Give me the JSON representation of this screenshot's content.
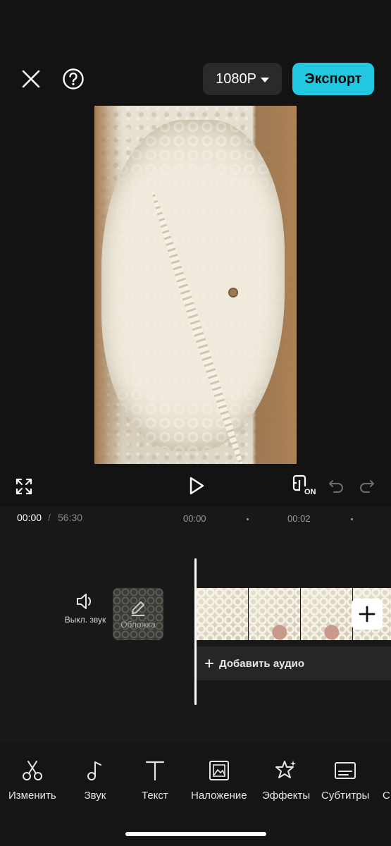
{
  "header": {
    "close_icon": "close-icon",
    "help_icon": "help-icon",
    "resolution_label": "1080P",
    "export_label": "Экспорт",
    "export_color": "#21c8e0"
  },
  "controls": {
    "fullscreen_icon": "fullscreen-icon",
    "play_icon": "play-icon",
    "preview_toggle_badge": "ON",
    "undo_icon": "undo-icon",
    "redo_icon": "redo-icon"
  },
  "timeline": {
    "current_time": "00:00",
    "separator": "/",
    "total_time": "56:30",
    "ticks": [
      "00:00",
      "00:02"
    ],
    "mute_label": "Выкл. звук",
    "cover_label": "Обложка",
    "add_audio_label": "Добавить аудио"
  },
  "toolbar": {
    "items": [
      {
        "label": "Изменить",
        "icon": "scissors-icon"
      },
      {
        "label": "Звук",
        "icon": "music-note-icon"
      },
      {
        "label": "Текст",
        "icon": "text-icon"
      },
      {
        "label": "Наложение",
        "icon": "overlay-icon"
      },
      {
        "label": "Эффекты",
        "icon": "effects-star-icon"
      },
      {
        "label": "Субтитры",
        "icon": "subtitles-icon"
      },
      {
        "label": "С",
        "icon": "partial-tool-icon"
      }
    ]
  }
}
